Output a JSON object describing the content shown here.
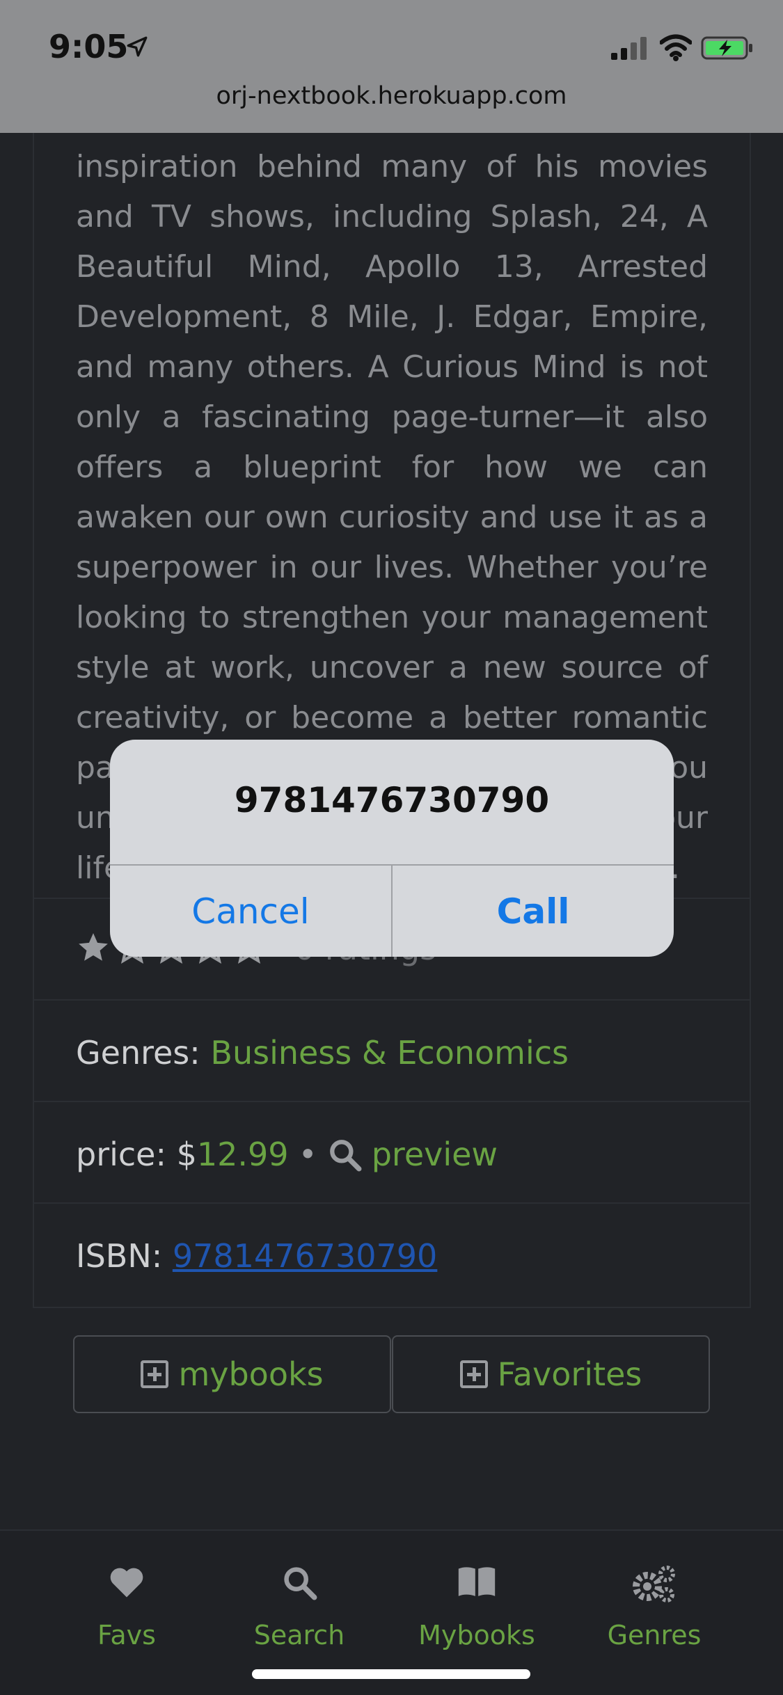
{
  "status_bar": {
    "time": "9:05",
    "url": "orj-nextbook.herokuapp.com"
  },
  "description": "discussions sparked the creative inspiration behind many of his movies and TV shows, including Splash, 24, A Beautiful Mind, Apollo 13, Arrested Development, 8 Mile, J. Edgar, Empire, and many others. A Curious Mind is not only a fascinating page-turner—it also offers a blueprint for how we can awaken our own curiosity and use it as a superpower in our lives. Whether you’re looking to strengthen your management style at work, uncover a new source of creativity, or become a better romantic partner, A Curious Mind will help you unlock the power of curiosity, in your life. Find out the power of the question.",
  "rating": {
    "filled_stars": 1,
    "total_stars": 5,
    "label": "0 ratings"
  },
  "genres": {
    "label": "Genres: ",
    "value": "Business & Economics"
  },
  "price": {
    "label": "price: $",
    "value": "12.99",
    "separator": "•",
    "preview_label": "preview"
  },
  "isbn": {
    "label": "ISBN: ",
    "value": "9781476730790"
  },
  "actions": {
    "mybooks_label": "mybooks",
    "favorites_label": "Favorites"
  },
  "nav": {
    "favs": "Favs",
    "search": "Search",
    "mybooks": "Mybooks",
    "genres": "Genres"
  },
  "alert": {
    "title": "9781476730790",
    "cancel": "Cancel",
    "call": "Call"
  },
  "colors": {
    "accent_green": "#6aa343",
    "ios_blue": "#1478e6",
    "background": "#212327"
  }
}
